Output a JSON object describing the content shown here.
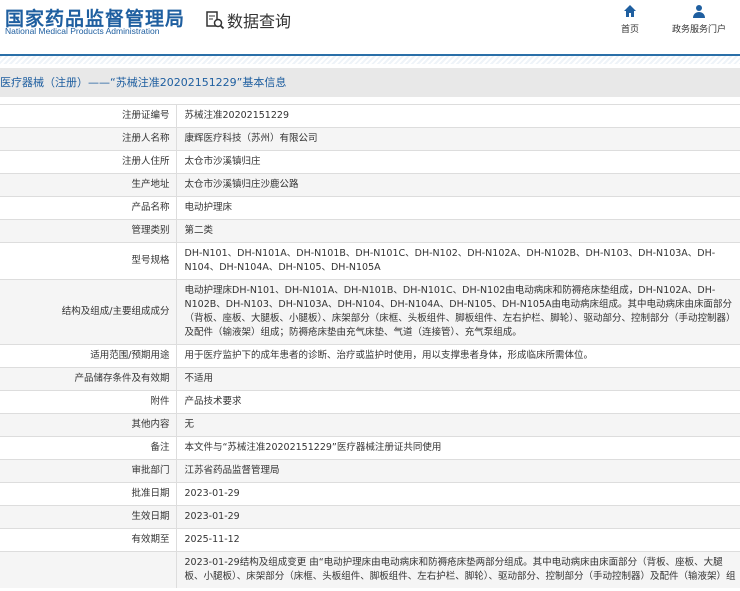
{
  "header": {
    "logo_cn": "国家药品监督管理局",
    "logo_en": "National Medical Products Administration",
    "query": "数据查询",
    "nav": [
      {
        "label": "首页",
        "icon": "home-icon"
      },
      {
        "label": "政务服务门户",
        "icon": "user-icon"
      }
    ]
  },
  "title": "医疗器械（注册）——“苏械注准20202151229”基本信息",
  "rows": [
    {
      "label": "注册证编号",
      "value": "苏械注准20202151229"
    },
    {
      "label": "注册人名称",
      "value": "康辉医疗科技（苏州）有限公司"
    },
    {
      "label": "注册人住所",
      "value": "太仓市沙溪镇归庄"
    },
    {
      "label": "生产地址",
      "value": "太仓市沙溪镇归庄沙鹿公路"
    },
    {
      "label": "产品名称",
      "value": "电动护理床"
    },
    {
      "label": "管理类别",
      "value": "第二类"
    },
    {
      "label": "型号规格",
      "value": "DH-N101、DH-N101A、DH-N101B、DH-N101C、DH-N102、DH-N102A、DH-N102B、DH-N103、DH-N103A、DH-N104、DH-N104A、DH-N105、DH-N105A"
    },
    {
      "label": "结构及组成/主要组成成分",
      "value": "电动护理床DH-N101、DH-N101A、DH-N101B、DH-N101C、DH-N102由电动病床和防褥疮床垫组成，DH-N102A、DH-N102B、DH-N103、DH-N103A、DH-N104、DH-N104A、DH-N105、DH-N105A由电动病床组成。其中电动病床由床面部分（背板、座板、大腿板、小腿板）、床架部分（床框、头板组件、脚板组件、左右护栏、脚轮）、驱动部分、控制部分（手动控制器）及配件（输液架）组成；防褥疮床垫由充气床垫、气道（连接管）、充气泵组成。"
    },
    {
      "label": "适用范围/预期用途",
      "value": "用于医疗监护下的成年患者的诊断、治疗或监护时使用，用以支撑患者身体，形成临床所需体位。"
    },
    {
      "label": "产品储存条件及有效期",
      "value": "不适用"
    },
    {
      "label": "附件",
      "value": "产品技术要求"
    },
    {
      "label": "其他内容",
      "value": "无"
    },
    {
      "label": "备注",
      "value": "本文件与“苏械注准20202151229”医疗器械注册证共同使用"
    },
    {
      "label": "审批部门",
      "value": "江苏省药品监督管理局"
    },
    {
      "label": "批准日期",
      "value": "2023-01-29"
    },
    {
      "label": "生效日期",
      "value": "2023-01-29"
    },
    {
      "label": "有效期至",
      "value": "2025-11-12"
    },
    {
      "label": "",
      "value": "2023-01-29结构及组成变更 由“电动护理床由电动病床和防褥疮床垫两部分组成。其中电动病床由床面部分（背板、座板、大腿板、小腿板）、床架部分（床框、头板组件、脚板组件、左右护栏、脚轮）、驱动部分、控制部分（手动控制器）及配件（输液架）组"
    }
  ]
}
